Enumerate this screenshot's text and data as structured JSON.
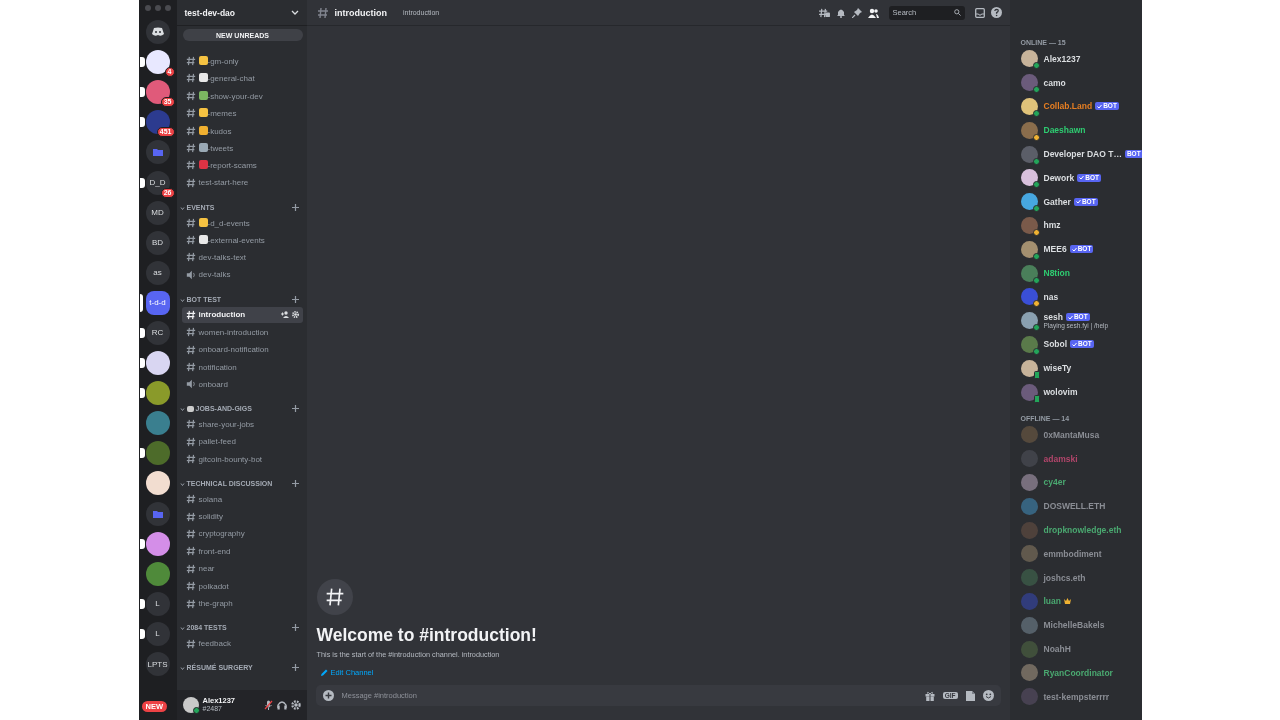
{
  "server_rail": {
    "items": [
      {
        "kind": "home",
        "selected": false,
        "unread": false
      },
      {
        "kind": "avatar",
        "color": "#e8e8ff",
        "badge": "4",
        "selected": false,
        "unread": true
      },
      {
        "kind": "avatar",
        "color": "#e05a7a",
        "badge": "35",
        "selected": false,
        "unread": true
      },
      {
        "kind": "avatar",
        "color": "#2c3b8f",
        "badge": "451",
        "selected": false,
        "unread": true
      },
      {
        "kind": "folder",
        "selected": false,
        "unread": false
      },
      {
        "kind": "text",
        "label": "D_D",
        "badge": "26",
        "selected": false,
        "unread": true
      },
      {
        "kind": "text",
        "label": "MD",
        "selected": false,
        "unread": false
      },
      {
        "kind": "text",
        "label": "BD",
        "selected": false,
        "unread": false
      },
      {
        "kind": "text",
        "label": "as",
        "selected": false,
        "unread": false
      },
      {
        "kind": "text",
        "label": "t-d-d",
        "selected": true,
        "unread": false
      },
      {
        "kind": "text",
        "label": "RC",
        "selected": false,
        "unread": true
      },
      {
        "kind": "avatar",
        "color": "#d9d6f2",
        "selected": false,
        "unread": true
      },
      {
        "kind": "avatar",
        "color": "#8a9a2a",
        "selected": false,
        "unread": true
      },
      {
        "kind": "avatar",
        "color": "#3a7f8f",
        "selected": false,
        "unread": false
      },
      {
        "kind": "avatar",
        "color": "#4d6b2a",
        "selected": false,
        "unread": true
      },
      {
        "kind": "avatar",
        "color": "#f2ddd0",
        "selected": false,
        "unread": false
      },
      {
        "kind": "folder",
        "selected": false,
        "unread": false
      },
      {
        "kind": "avatar",
        "color": "#d48ee8",
        "selected": false,
        "unread": true
      },
      {
        "kind": "avatar",
        "color": "#4f8a3a",
        "selected": false,
        "unread": false
      },
      {
        "kind": "text",
        "label": "L",
        "selected": false,
        "unread": true
      },
      {
        "kind": "text",
        "label": "L",
        "selected": false,
        "unread": true
      },
      {
        "kind": "text",
        "label": "LPTS",
        "selected": false,
        "unread": false
      }
    ],
    "new_badge": "NEW"
  },
  "sidebar": {
    "server_name": "test-dev-dao",
    "new_unreads": "NEW UNREADS",
    "categories": [
      {
        "channels": [
          {
            "name": "-gm-only",
            "kind": "text",
            "emoji": true,
            "selected": false
          },
          {
            "name": "-general-chat",
            "kind": "text",
            "emoji": true,
            "selected": false
          },
          {
            "name": "-show-your-dev",
            "kind": "text",
            "emoji": true,
            "selected": false
          },
          {
            "name": "-memes",
            "kind": "text",
            "emoji": true,
            "selected": false
          },
          {
            "name": "-kudos",
            "kind": "text",
            "emoji": true,
            "selected": false
          },
          {
            "name": "-tweets",
            "kind": "text",
            "emoji": true,
            "selected": false
          },
          {
            "name": "-report-scams",
            "kind": "text",
            "emoji": true,
            "selected": false
          },
          {
            "name": "test-start-here",
            "kind": "text",
            "emoji": false,
            "selected": false
          }
        ]
      },
      {
        "name": "EVENTS",
        "channels": [
          {
            "name": "-d_d-events",
            "kind": "text",
            "emoji": true,
            "selected": false
          },
          {
            "name": "-external-events",
            "kind": "text",
            "emoji": true,
            "selected": false
          },
          {
            "name": "dev-talks-text",
            "kind": "text",
            "emoji": false,
            "selected": false
          },
          {
            "name": "dev-talks",
            "kind": "voice",
            "emoji": false,
            "selected": false
          }
        ]
      },
      {
        "name": "BOT TEST",
        "channels": [
          {
            "name": "introduction",
            "kind": "text",
            "selected": true
          },
          {
            "name": "women-introduction",
            "kind": "text",
            "selected": false
          },
          {
            "name": "onboard-notification",
            "kind": "text",
            "selected": false
          },
          {
            "name": "notification",
            "kind": "text",
            "selected": false
          },
          {
            "name": "onboard",
            "kind": "voice",
            "selected": false
          }
        ]
      },
      {
        "name": "JOBS-AND-GIGS",
        "emoji": true,
        "channels": [
          {
            "name": "share-your-jobs",
            "kind": "text",
            "selected": false
          },
          {
            "name": "pallet-feed",
            "kind": "text",
            "selected": false
          },
          {
            "name": "gitcoin-bounty-bot",
            "kind": "text",
            "selected": false
          }
        ]
      },
      {
        "name": "TECHNICAL DISCUSSION",
        "channels": [
          {
            "name": "solana",
            "kind": "text",
            "selected": false
          },
          {
            "name": "solidity",
            "kind": "text",
            "selected": false
          },
          {
            "name": "cryptography",
            "kind": "text",
            "selected": false
          },
          {
            "name": "front-end",
            "kind": "text",
            "selected": false
          },
          {
            "name": "near",
            "kind": "text",
            "selected": false
          },
          {
            "name": "polkadot",
            "kind": "text",
            "selected": false
          },
          {
            "name": "the-graph",
            "kind": "text",
            "selected": false
          }
        ]
      },
      {
        "name": "2084 TESTS",
        "channels": [
          {
            "name": "feedback",
            "kind": "text",
            "selected": false
          }
        ]
      },
      {
        "name": "RÉSUMÉ SURGERY"
      }
    ],
    "user": {
      "name": "Alex1237",
      "tag": "#2487",
      "muted": true
    }
  },
  "chat": {
    "channel": "introduction",
    "topic": "introduction",
    "search": {
      "placeholder": "Search"
    },
    "welcome_title": "Welcome to #introduction!",
    "welcome_text": "This is the start of the #introduction channel. introduction",
    "edit_link": "Edit Channel",
    "composer": {
      "placeholder": "Message #introduction",
      "gif": "GIF"
    }
  },
  "members": {
    "sections": [
      {
        "title": "ONLINE — 15",
        "offline": false,
        "items": [
          {
            "name": "Alex1237",
            "color": "#dbdee1",
            "idle": false,
            "mobile": false
          },
          {
            "name": "camo",
            "color": "#dbdee1",
            "idle": false,
            "mobile": false
          },
          {
            "name": "Collab.Land",
            "color": "#e67e22",
            "idle": false,
            "mobile": false,
            "bot": {
              "label": "BOT",
              "verified": true
            }
          },
          {
            "name": "Daeshawn",
            "color": "#2ecc71",
            "idle": true,
            "mobile": false
          },
          {
            "name": "Developer DAO T…",
            "color": "#dbdee1",
            "idle": false,
            "mobile": false,
            "bot": {
              "label": "BOT",
              "verified": false
            }
          },
          {
            "name": "Dework",
            "color": "#dbdee1",
            "idle": false,
            "mobile": false,
            "bot": {
              "label": "BOT",
              "verified": true
            }
          },
          {
            "name": "Gather",
            "color": "#dbdee1",
            "idle": false,
            "mobile": false,
            "bot": {
              "label": "BOT",
              "verified": true
            }
          },
          {
            "name": "hmz",
            "color": "#dbdee1",
            "idle": true,
            "mobile": false
          },
          {
            "name": "MEE6",
            "color": "#dbdee1",
            "idle": false,
            "mobile": false,
            "bot": {
              "label": "BOT",
              "verified": true
            }
          },
          {
            "name": "N8tion",
            "color": "#2ecc71",
            "idle": false,
            "mobile": false
          },
          {
            "name": "nas",
            "color": "#dbdee1",
            "idle": true,
            "mobile": false
          },
          {
            "name": "sesh",
            "color": "#dbdee1",
            "idle": false,
            "mobile": false,
            "bot": {
              "label": "BOT",
              "verified": true
            },
            "activity": "Playing sesh.fyi | /help"
          },
          {
            "name": "Sobol",
            "color": "#dbdee1",
            "idle": false,
            "mobile": false,
            "bot": {
              "label": "BOT",
              "verified": true
            }
          },
          {
            "name": "wiseTy",
            "color": "#dbdee1",
            "idle": false,
            "mobile": true
          },
          {
            "name": "wolovim",
            "color": "#dbdee1",
            "idle": false,
            "mobile": true
          }
        ]
      },
      {
        "title": "OFFLINE — 14",
        "offline": true,
        "items": [
          {
            "name": "0xMantaMusa",
            "color": "#8a8d94"
          },
          {
            "name": "adamski",
            "color": "#b0456a"
          },
          {
            "name": "cy4er",
            "color": "#4aa870"
          },
          {
            "name": "DOSWELL.ETH",
            "color": "#8a8d94"
          },
          {
            "name": "dropknowledge.eth",
            "color": "#4aa870"
          },
          {
            "name": "emmbodiment",
            "color": "#8a8d94"
          },
          {
            "name": "joshcs.eth",
            "color": "#8a8d94"
          },
          {
            "name": "luan",
            "color": "#4aa870",
            "crown": true
          },
          {
            "name": "MichelleBakels",
            "color": "#8a8d94"
          },
          {
            "name": "NoahH",
            "color": "#8a8d94"
          },
          {
            "name": "RyanCoordinator",
            "color": "#4aa870"
          },
          {
            "name": "test-kempsterrrr",
            "color": "#8a8d94"
          }
        ]
      }
    ]
  }
}
